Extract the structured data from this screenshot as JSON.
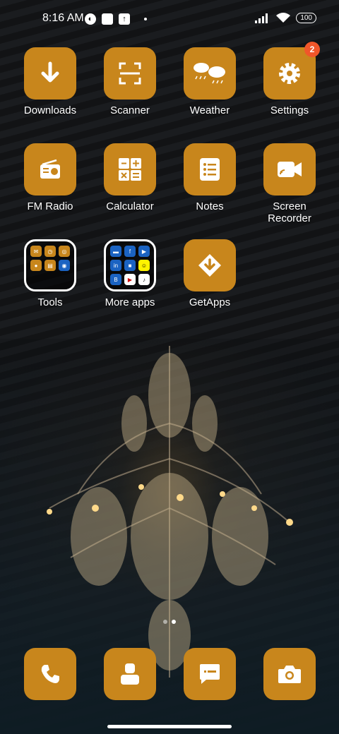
{
  "status_bar": {
    "time": "8:16 AM",
    "battery": "100"
  },
  "home": {
    "apps": [
      {
        "label": "Downloads",
        "icon": "download-icon"
      },
      {
        "label": "Scanner",
        "icon": "scanner-icon"
      },
      {
        "label": "Weather",
        "icon": "weather-icon"
      },
      {
        "label": "Settings",
        "icon": "gear-icon",
        "badge": "2"
      },
      {
        "label": "FM Radio",
        "icon": "radio-icon"
      },
      {
        "label": "Calculator",
        "icon": "calculator-icon"
      },
      {
        "label": "Notes",
        "icon": "notes-icon"
      },
      {
        "label": "Screen Recorder",
        "icon": "screen-recorder-icon"
      },
      {
        "label": "Tools",
        "icon": "folder-icon"
      },
      {
        "label": "More apps",
        "icon": "folder-icon"
      },
      {
        "label": "GetApps",
        "icon": "getapps-icon"
      }
    ]
  },
  "dock": [
    {
      "icon": "phone-icon"
    },
    {
      "icon": "contacts-icon"
    },
    {
      "icon": "messages-icon"
    },
    {
      "icon": "camera-icon"
    }
  ],
  "pager": {
    "pages": 2,
    "current": 2
  },
  "colors": {
    "tile": "#c8861c",
    "badge": "#f0562a"
  }
}
